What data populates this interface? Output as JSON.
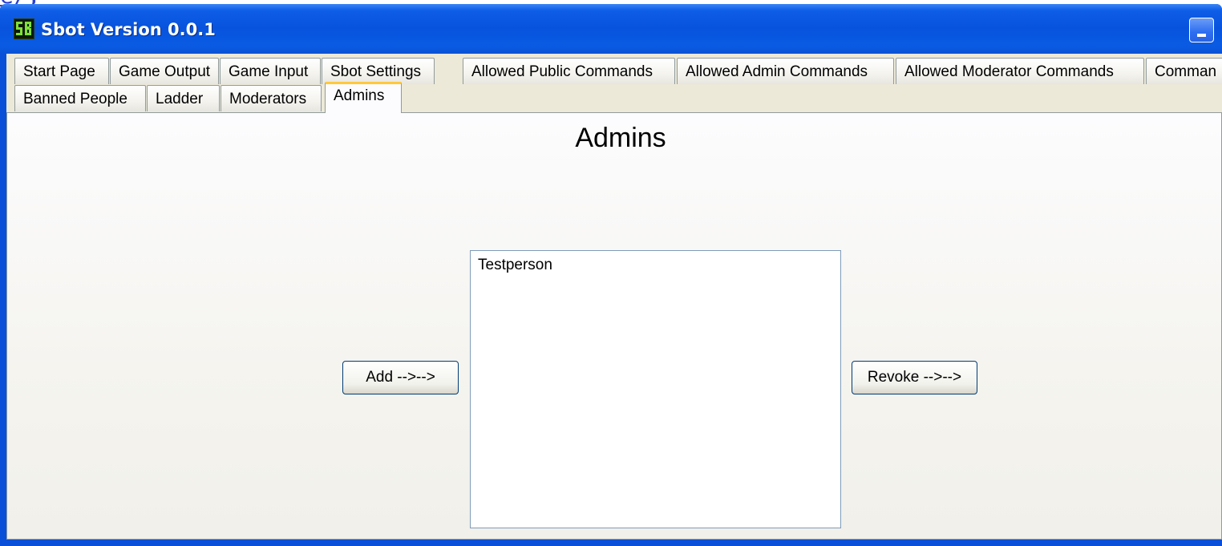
{
  "browser_link": "e/,",
  "window": {
    "title": "Sbot Version 0.0.1",
    "app_icon": "sbot-logo-icon",
    "minimize_icon": "minimize-icon"
  },
  "tabs": {
    "row1": [
      {
        "label": "Start Page"
      },
      {
        "label": "Game Output"
      },
      {
        "label": "Game Input"
      },
      {
        "label": "Sbot Settings"
      },
      {
        "label": "Allowed Public Commands"
      },
      {
        "label": "Allowed Admin Commands"
      },
      {
        "label": "Allowed Moderator Commands"
      },
      {
        "label": "Comman"
      }
    ],
    "row2": [
      {
        "label": "Banned People"
      },
      {
        "label": "Ladder"
      },
      {
        "label": "Moderators"
      },
      {
        "label": "Admins",
        "active": true
      }
    ]
  },
  "panel": {
    "heading": "Admins",
    "add_button": "Add -->-->",
    "revoke_button": "Revoke -->-->",
    "admins_list": [
      "Testperson"
    ]
  },
  "colors": {
    "titlebar": "#0a5be3",
    "active_tab_accent": "#ffc83c",
    "client_bg": "#ece9d8"
  }
}
